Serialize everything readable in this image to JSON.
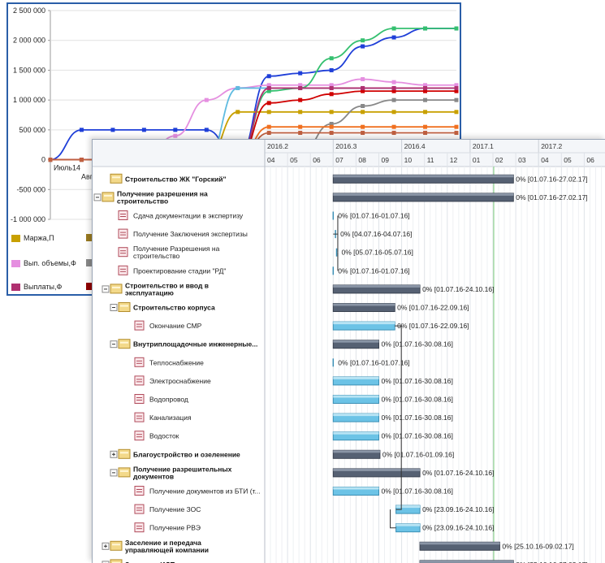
{
  "chart_window": {
    "chart_data": {
      "type": "line",
      "y_ticks": [
        "2 500 000",
        "2 000 000",
        "1 500 000",
        "1 000 000",
        "500 000",
        "0",
        "-500 000",
        "-1 000 000"
      ],
      "ylim": [
        -1000000,
        2500000
      ],
      "x_tick_labels": [
        "Июль14",
        "Авг"
      ],
      "series": [
        {
          "color": "#1f3fd8",
          "values": [
            0,
            500000,
            500000,
            500000,
            500000,
            500000,
            0,
            1400000,
            1450000,
            1500000,
            1900000,
            2050000,
            2200000,
            2200000
          ]
        },
        {
          "color": "#e58fe0",
          "values": [
            0,
            0,
            0,
            0,
            400000,
            1000000,
            1200000,
            1250000,
            1250000,
            1250000,
            1350000,
            1300000,
            1250000,
            1250000
          ]
        },
        {
          "color": "#5fbbe0",
          "values": [
            0,
            0,
            0,
            0,
            0,
            0,
            1200000,
            1200000,
            1200000,
            1200000,
            1200000,
            1200000,
            1200000,
            1200000
          ]
        },
        {
          "color": "#35c070",
          "values": [
            0,
            0,
            0,
            0,
            0,
            0,
            0,
            1150000,
            1200000,
            1700000,
            2000000,
            2200000,
            2200000,
            2200000
          ]
        },
        {
          "color": "#c8a000",
          "values": [
            0,
            0,
            0,
            0,
            0,
            0,
            800000,
            800000,
            800000,
            800000,
            800000,
            800000,
            800000,
            800000
          ]
        },
        {
          "color": "#d00000",
          "values": [
            0,
            0,
            0,
            0,
            0,
            0,
            0,
            950000,
            1000000,
            1100000,
            1150000,
            1150000,
            1150000,
            1150000
          ]
        },
        {
          "color": "#888888",
          "values": [
            0,
            0,
            0,
            0,
            0,
            0,
            0,
            0,
            100000,
            600000,
            900000,
            1000000,
            1000000,
            1000000
          ]
        },
        {
          "color": "#f07020",
          "values": [
            0,
            0,
            0,
            0,
            0,
            0,
            0,
            550000,
            550000,
            550000,
            550000,
            550000,
            550000,
            550000
          ]
        },
        {
          "color": "#b03070",
          "values": [
            0,
            0,
            0,
            0,
            0,
            0,
            0,
            1200000,
            1200000,
            1200000,
            1200000,
            1200000,
            1200000,
            1200000
          ]
        },
        {
          "color": "#c06040",
          "values": [
            0,
            0,
            0,
            0,
            0,
            0,
            0,
            450000,
            450000,
            450000,
            450000,
            450000,
            450000,
            450000
          ]
        }
      ]
    },
    "legend": [
      {
        "label": "Маржа,П",
        "color": "#c8a000"
      },
      {
        "label": "Вып. объемы,Ф",
        "color": "#e58fe0"
      },
      {
        "label": "Выплаты,Ф",
        "color": "#b03070"
      }
    ],
    "legend_extra_swatches": [
      "#9a7a20",
      "#888888",
      "#900000"
    ]
  },
  "gantt": {
    "years": [
      "2016.2",
      "2016.3",
      "2016.4",
      "2017.1",
      "2017.2"
    ],
    "months": [
      "04",
      "05",
      "06",
      "07",
      "08",
      "09",
      "10",
      "11",
      "12",
      "01",
      "02",
      "03",
      "04",
      "05",
      "06"
    ],
    "rows": [
      {
        "name": "Строительство ЖК \"Горский\"",
        "bold": true,
        "level": 0,
        "expander": "",
        "icon": "folder",
        "bar": {
          "type": "summary",
          "start": 3.0,
          "end": 10.9
        },
        "label": "0% [01.07.16-27.02.17]"
      },
      {
        "name": "Получение разрешения на строительство",
        "bold": true,
        "level": 0,
        "expander": "⊟",
        "icon": "folder",
        "bar": {
          "type": "summary",
          "start": 3.0,
          "end": 10.9
        },
        "label": "0% [01.07.16-27.02.17]"
      },
      {
        "name": "Сдача документации в экспертизу",
        "bold": false,
        "level": 1,
        "expander": "",
        "icon": "task",
        "bar": {
          "type": "milestone",
          "start": 3.0,
          "end": 3.0
        },
        "label": "0% [01.07.16-01.07.16]"
      },
      {
        "name": "Получение Заключения экспертизы",
        "bold": false,
        "level": 1,
        "expander": "",
        "icon": "task",
        "bar": {
          "type": "milestone",
          "start": 3.1,
          "end": 3.1
        },
        "label": "0% [04.07.16-04.07.16]"
      },
      {
        "name": "Получение Разрешения на строительство",
        "bold": false,
        "level": 1,
        "expander": "",
        "icon": "task",
        "bar": {
          "type": "milestone",
          "start": 3.15,
          "end": 3.15
        },
        "label": "0% [05.07.16-05.07.16]"
      },
      {
        "name": "Проектирование стадии \"РД\"",
        "bold": false,
        "level": 1,
        "expander": "",
        "icon": "task",
        "bar": {
          "type": "milestone",
          "start": 3.0,
          "end": 3.0
        },
        "label": "0% [01.07.16-01.07.16]"
      },
      {
        "name": "Строительство и ввод в эксплуатацию",
        "bold": true,
        "level": 1,
        "expander": "⊟",
        "icon": "folder",
        "bar": {
          "type": "summary",
          "start": 3.0,
          "end": 6.8
        },
        "label": "0% [01.07.16-24.10.16]"
      },
      {
        "name": "Строительство корпуса",
        "bold": true,
        "level": 2,
        "expander": "⊟",
        "icon": "folder",
        "bar": {
          "type": "summary",
          "start": 3.0,
          "end": 5.7
        },
        "label": "0% [01.07.16-22.09.16]"
      },
      {
        "name": "Окончание СМР",
        "bold": false,
        "level": 3,
        "expander": "",
        "icon": "task",
        "bar": {
          "type": "task",
          "start": 3.0,
          "end": 5.7
        },
        "label": "0% [01.07.16-22.09.16]"
      },
      {
        "name": "Внутриплощадочные инженерные...",
        "bold": true,
        "level": 2,
        "expander": "⊟",
        "icon": "folder",
        "bar": {
          "type": "summary",
          "start": 3.0,
          "end": 5.0
        },
        "label": "0% [01.07.16-30.08.16]"
      },
      {
        "name": "Теплоснабжение",
        "bold": false,
        "level": 3,
        "expander": "",
        "icon": "task",
        "bar": {
          "type": "milestone",
          "start": 3.0,
          "end": 3.0
        },
        "label": "0% [01.07.16-01.07.16]"
      },
      {
        "name": "Электроснабжение",
        "bold": false,
        "level": 3,
        "expander": "",
        "icon": "task",
        "bar": {
          "type": "task",
          "start": 3.0,
          "end": 5.0
        },
        "label": "0% [01.07.16-30.08.16]"
      },
      {
        "name": "Водопровод",
        "bold": false,
        "level": 3,
        "expander": "",
        "icon": "task",
        "bar": {
          "type": "task",
          "start": 3.0,
          "end": 5.0
        },
        "label": "0% [01.07.16-30.08.16]"
      },
      {
        "name": "Канализация",
        "bold": false,
        "level": 3,
        "expander": "",
        "icon": "task",
        "bar": {
          "type": "task",
          "start": 3.0,
          "end": 5.0
        },
        "label": "0% [01.07.16-30.08.16]"
      },
      {
        "name": "Водосток",
        "bold": false,
        "level": 3,
        "expander": "",
        "icon": "task",
        "bar": {
          "type": "task",
          "start": 3.0,
          "end": 5.0
        },
        "label": "0% [01.07.16-30.08.16]"
      },
      {
        "name": "Благоустройство и озеленение",
        "bold": true,
        "level": 2,
        "expander": "⊞",
        "icon": "folder",
        "bar": {
          "type": "summary",
          "start": 3.0,
          "end": 5.05
        },
        "label": "0% [01.07.16-01.09.16]"
      },
      {
        "name": "Получение разрешительных документов",
        "bold": true,
        "level": 2,
        "expander": "⊟",
        "icon": "folder",
        "bar": {
          "type": "summary",
          "start": 3.0,
          "end": 6.8
        },
        "label": "0% [01.07.16-24.10.16]"
      },
      {
        "name": "Получение документов из БТИ (т...",
        "bold": false,
        "level": 3,
        "expander": "",
        "icon": "task",
        "bar": {
          "type": "task",
          "start": 3.0,
          "end": 5.0
        },
        "label": "0% [01.07.16-30.08.16]"
      },
      {
        "name": "Получение ЗОС",
        "bold": false,
        "level": 3,
        "expander": "",
        "icon": "task",
        "bar": {
          "type": "task",
          "start": 5.75,
          "end": 6.8
        },
        "label": "0% [23.09.16-24.10.16]"
      },
      {
        "name": "Получение РВЭ",
        "bold": false,
        "level": 3,
        "expander": "",
        "icon": "task",
        "bar": {
          "type": "task",
          "start": 5.75,
          "end": 6.8
        },
        "label": "0% [23.09.16-24.10.16]"
      },
      {
        "name": "Заселение и передача управляющей компании",
        "bold": true,
        "level": 1,
        "expander": "⊞",
        "icon": "folder",
        "bar": {
          "type": "summary",
          "start": 6.8,
          "end": 10.3
        },
        "label": "0% [25.10.16-09.02.17]"
      },
      {
        "name": "Закрытие ИДП",
        "bold": true,
        "level": 1,
        "expander": "⊞",
        "icon": "folder",
        "bar": {
          "type": "summary",
          "start": 6.8,
          "end": 10.9
        },
        "label": "0% [25.10.16-27.02.17]"
      }
    ]
  }
}
